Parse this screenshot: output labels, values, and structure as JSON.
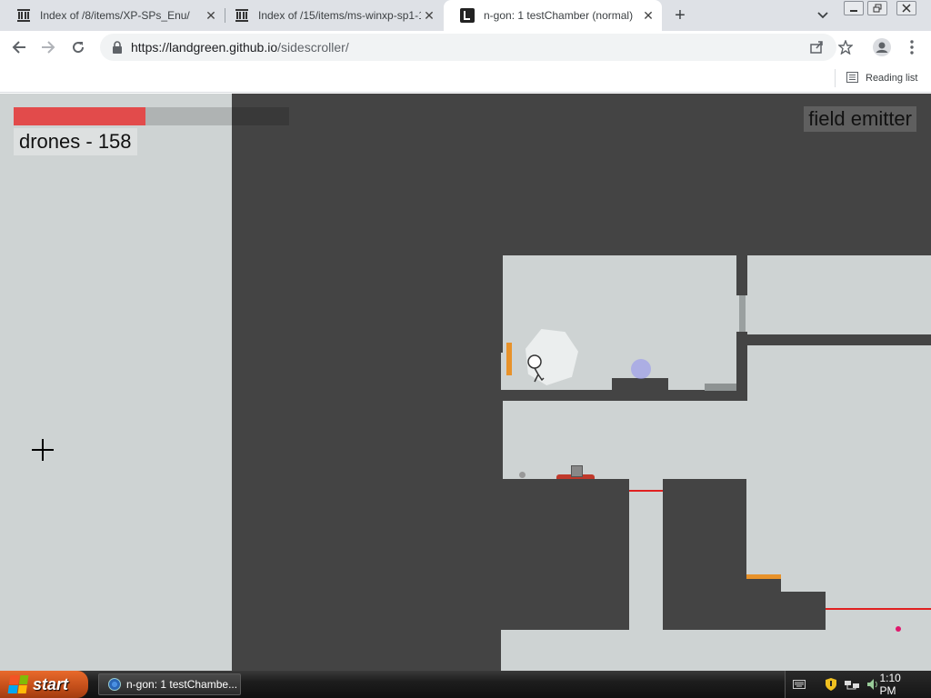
{
  "browser": {
    "tabs": [
      {
        "title": "Index of /8/items/XP-SPs_Enu/",
        "favicon": "archive-org-icon",
        "active": false
      },
      {
        "title": "Index of /15/items/ms-winxp-sp1-1(",
        "favicon": "archive-org-icon",
        "active": false
      },
      {
        "title": "n-gon: 1 testChamber (normal)",
        "favicon": "n-gon-icon",
        "active": true
      }
    ],
    "new_tab_symbol": "+",
    "url_host": "https://landgreen.github.io",
    "url_path": "/sidescroller/",
    "reading_list_label": "Reading list"
  },
  "game": {
    "health_fraction": 0.48,
    "gun_label": "drones - 158",
    "field_label": "field emitter",
    "colors": {
      "background": "#ced3d3",
      "wall": "#444444",
      "health": "#e24b4b",
      "laser": "#e02020",
      "door": "#e8922a",
      "bullet": "#e0186c"
    }
  },
  "taskbar": {
    "start_label": "start",
    "task_label": "n-gon: 1 testChambe...",
    "clock": "1:10 PM"
  }
}
